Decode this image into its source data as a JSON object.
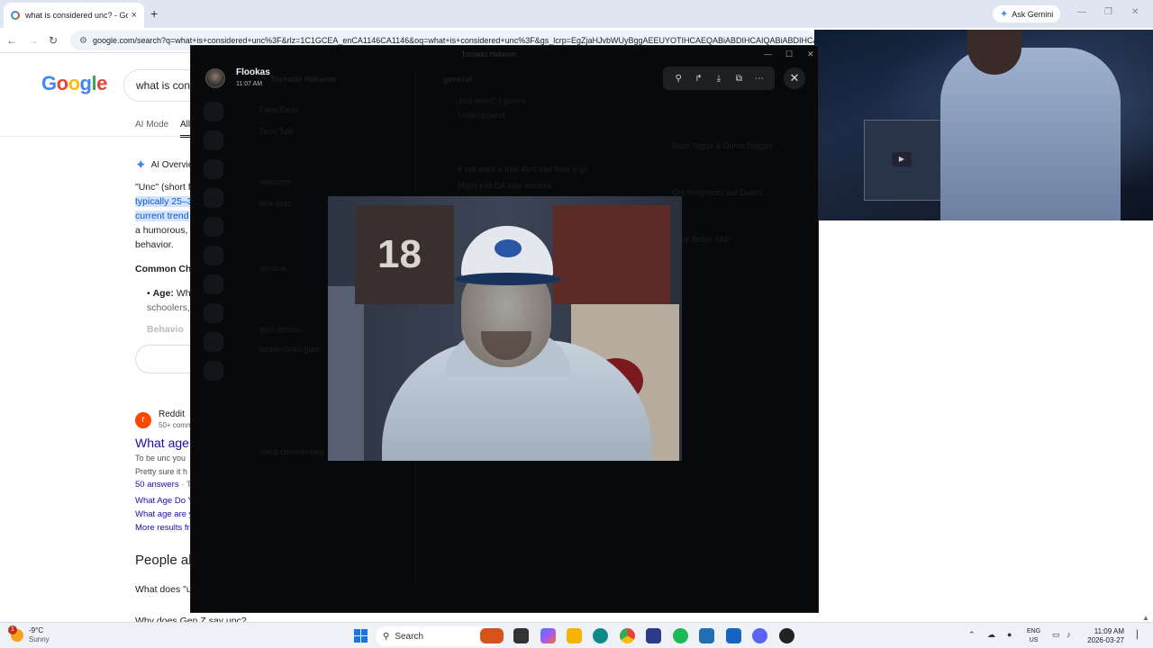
{
  "browser": {
    "tab_title": "what is considered unc? - Goog",
    "tab_close": "×",
    "new_tab": "+",
    "ask_gemini": "Ask Gemini",
    "url": "google.com/search?q=what+is+considered+unc%3F&rlz=1C1GCEA_enCA1146CA1146&oq=what+is+considered+unc%3F&gs_lcrp=EgZjaHJvbWUyBggAEEUYOTIHCAEQABiABDIHCAIQABiABDIHCAMQ"
  },
  "google": {
    "search_value": "what is consi",
    "tabs": [
      "AI Mode",
      "All"
    ],
    "ai_overview": "AI Overvie",
    "answer_lines": [
      "\"Unc\" (short f",
      "typically 25–3",
      "current trend",
      "a humorous,",
      "behavior."
    ],
    "common_heading": "Common Ch",
    "age_label": "Age:",
    "age_text": "Whil",
    "age_line2": "schoolers,",
    "behavior_label": "Behavio",
    "reddit": {
      "source": "Reddit",
      "meta": "50+ comm",
      "title": "What age",
      "snippet1": "To be unc you",
      "snippet2": "Pretty sure it h",
      "answers": "50 answers",
      "answers_sep": "· T",
      "link1": "What Age Do Y",
      "link2": "What age are y",
      "more": "More results fr"
    },
    "people_also": "People al",
    "paa1": "What does \"u",
    "paa2": "Why does Gen Z say unc?"
  },
  "viewer": {
    "user": "Flookas",
    "time": "11:07 AM",
    "close_glyph": "✕"
  },
  "discord_bg": {
    "window_title": "Tornado Hakeem",
    "server": "Tornado Hakeem",
    "channel": "general",
    "ghost_lines": [
      "welcome",
      "kick-outz",
      "general",
      "gym-fitness",
      "lockie-locks-gam",
      "meta-commentary",
      "Fake Dead",
      "Tech Talk",
      "Just seen? I guess",
      "Underground",
      "if yall want a free 4hrs trial here u go",
      "Might just DA way amount"
    ],
    "right_ghost": [
      "Bitch Nigga & Dumb Niggas",
      "Old Neighbors are Dumb",
      "Love Brittle Skill"
    ]
  },
  "taskbar": {
    "temp": "-9°C",
    "weather": "Sunny",
    "weather_badge": "1",
    "search": "Search",
    "lang1": "ENG",
    "lang2": "US",
    "time": "11:09 AM",
    "date": "2026-03-27"
  }
}
